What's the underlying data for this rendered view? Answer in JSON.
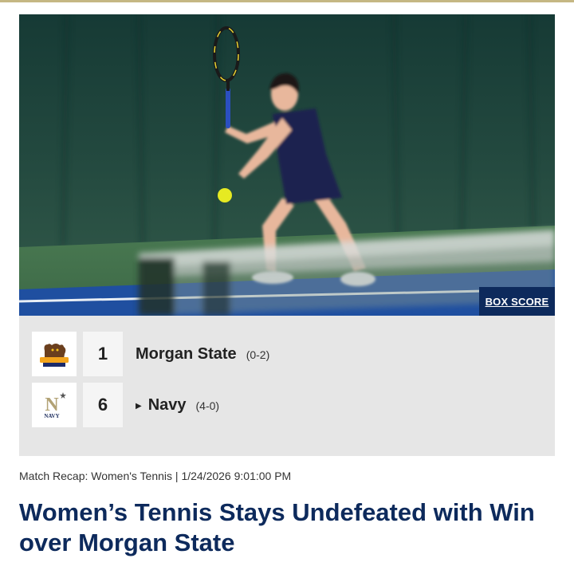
{
  "colors": {
    "accent_rule": "#c5b783",
    "navy_blue": "#0d2a5c",
    "panel_bg": "#e6e6e6"
  },
  "hero": {
    "image_alt": "Navy women's tennis player hitting a forehand",
    "box_score_label": "BOX SCORE"
  },
  "scoreboard": {
    "teams": [
      {
        "name": "Morgan State",
        "record": "(0-2)",
        "score": "1",
        "logo": "morgan-state-bear-logo",
        "winner": false
      },
      {
        "name": "Navy",
        "record": "(4-0)",
        "score": "6",
        "logo": "navy-n-logo",
        "winner": true
      }
    ]
  },
  "article": {
    "meta": "Match Recap: Women's Tennis | 1/24/2026 9:01:00 PM",
    "headline": "Women’s Tennis Stays Undefeated with Win over Morgan State"
  }
}
